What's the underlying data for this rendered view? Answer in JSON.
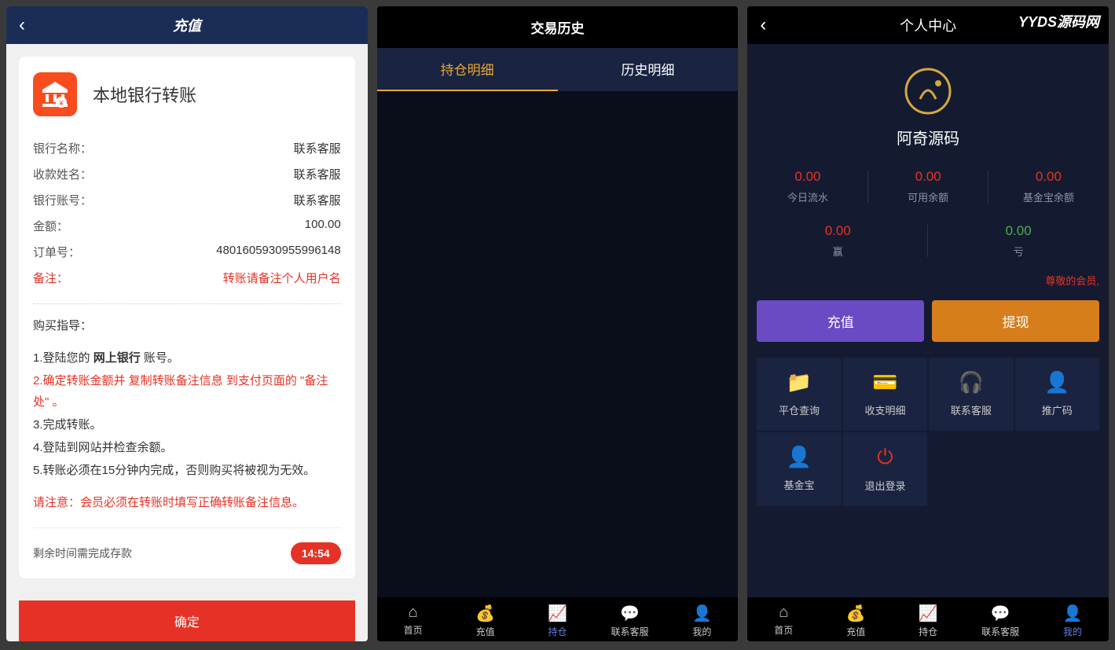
{
  "screen1": {
    "title": "充值",
    "bank_title": "本地银行转账",
    "rows": {
      "bank_name_label": "银行名称：",
      "bank_name_val": "联系客服",
      "payee_label": "收款姓名：",
      "payee_val": "联系客服",
      "account_label": "银行账号：",
      "account_val": "联系客服",
      "amount_label": "金额：",
      "amount_val": "100.00",
      "order_label": "订单号：",
      "order_val": "4801605930955996148",
      "remark_label": "备注：",
      "remark_val": "转账请备注个人用户名"
    },
    "guide_title": "购买指导：",
    "guide": {
      "g1a": "1.登陆您的 ",
      "g1b": "网上银行",
      "g1c": " 账号。",
      "g2": "2.确定转账金额并 复制转账备注信息 到支付页面的 \"备注处\" 。",
      "g3": "3.完成转账。",
      "g4": "4.登陆到网站并检查余额。",
      "g5": "5.转账必须在15分钟内完成，否则购买将被视为无效。"
    },
    "note": "请注意：会员必须在转账时填写正确转账备注信息。",
    "countdown_label": "剩余时间需完成存款",
    "countdown_val": "14:54",
    "confirm": "确定"
  },
  "screen2": {
    "title": "交易历史",
    "tab1": "持仓明细",
    "tab2": "历史明细",
    "nav": {
      "home": "首页",
      "recharge": "充值",
      "position": "持仓",
      "service": "联系客服",
      "mine": "我的"
    }
  },
  "screen3": {
    "title": "个人中心",
    "watermark": "YYDS源码网",
    "username": "阿奇源码",
    "stats": {
      "s1_val": "0.00",
      "s1_label": "今日流水",
      "s2_val": "0.00",
      "s2_label": "可用余额",
      "s3_val": "0.00",
      "s3_label": "基金宝余额",
      "s4_val": "0.00",
      "s4_label": "赢",
      "s5_val": "0.00",
      "s5_label": "亏"
    },
    "member_notice": "尊敬的会员,",
    "action_recharge": "充值",
    "action_withdraw": "提现",
    "grid": {
      "g1": "平仓查询",
      "g2": "收支明细",
      "g3": "联系客服",
      "g4": "推广码",
      "g5": "基金宝",
      "g6": "退出登录"
    },
    "nav": {
      "home": "首页",
      "recharge": "充值",
      "position": "持仓",
      "service": "联系客服",
      "mine": "我的"
    }
  }
}
